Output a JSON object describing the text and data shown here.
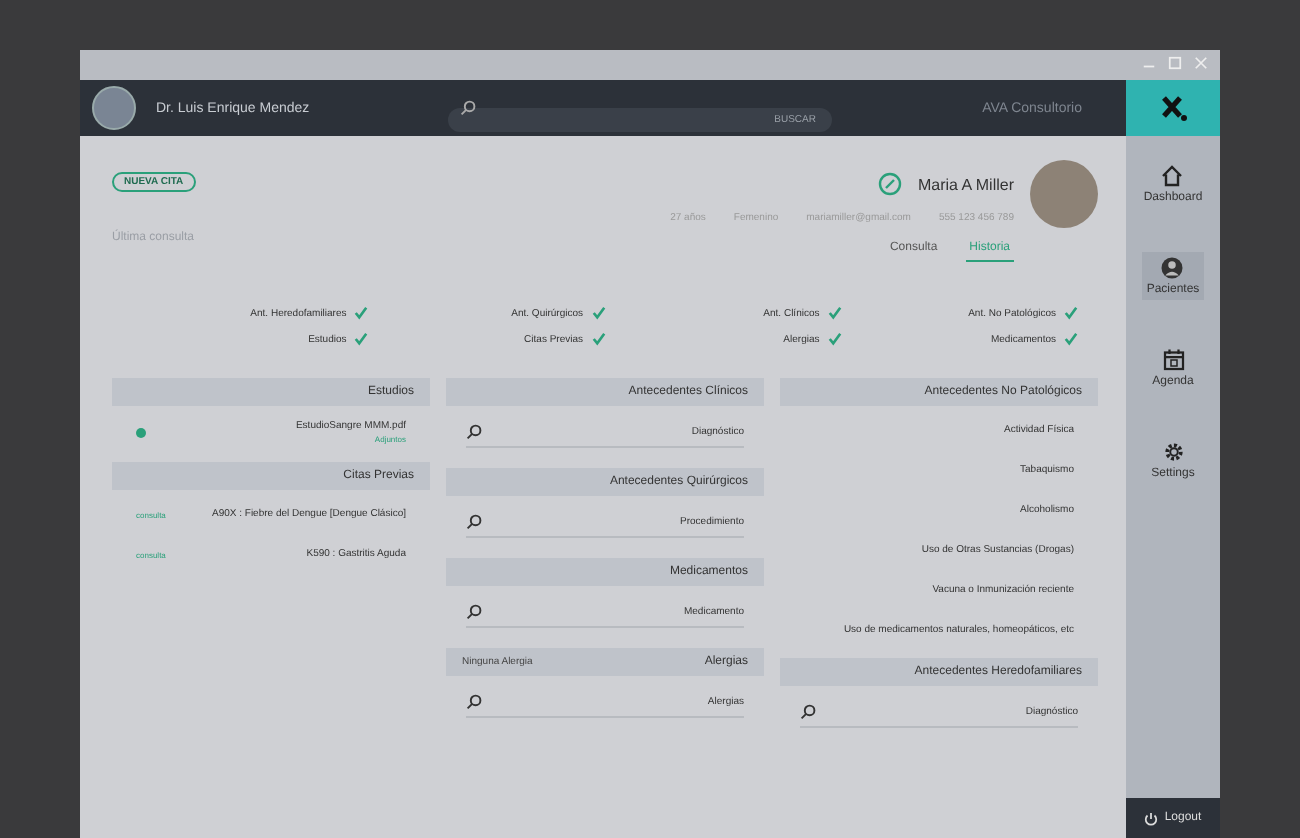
{
  "header": {
    "doctor": "Dr. Luis Enrique Mendez",
    "search": {
      "placeholder": "BUSCAR"
    },
    "app_title": "AVA Consultorio"
  },
  "sidebar": {
    "items": [
      {
        "label": "Dashboard",
        "selected": false
      },
      {
        "label": "Pacientes",
        "selected": true
      },
      {
        "label": "Agenda",
        "selected": false
      },
      {
        "label": "Settings",
        "selected": false
      }
    ],
    "logout": "Logout"
  },
  "patient": {
    "name": "Maria A Miller",
    "info": [
      "27 años",
      "Femenino",
      "mariamiller@gmail.com",
      "555 123 456 789"
    ],
    "new_appointment": "NUEVA CITA",
    "last_visit": "Última consulta"
  },
  "tabs": [
    {
      "label": "Consulta",
      "selected": false
    },
    {
      "label": "Historia",
      "selected": true
    }
  ],
  "filters": [
    {
      "label": "Ant. Heredofamiliares",
      "checked": true
    },
    {
      "label": "Ant. Quirúrgicos",
      "checked": true
    },
    {
      "label": "Ant. Clínicos",
      "checked": true
    },
    {
      "label": "Ant. No Patológicos",
      "checked": true
    },
    {
      "label": "Estudios",
      "checked": true
    },
    {
      "label": "Citas Previas",
      "checked": true
    },
    {
      "label": "Alergias",
      "checked": true
    },
    {
      "label": "Medicamentos",
      "checked": true
    }
  ],
  "columns": [
    [
      {
        "title": "Estudios",
        "items": [
          {
            "kind": "file",
            "label": "EstudioSangre MMM.pdf",
            "link": "Adjuntos"
          }
        ]
      },
      {
        "title": "Citas Previas",
        "items": [
          {
            "kind": "visit",
            "label": "A90X : Fiebre del Dengue [Dengue Clásico]",
            "link": "consulta"
          },
          {
            "kind": "visit",
            "label": "K590 : Gastritis Aguda",
            "link": "consulta"
          }
        ]
      }
    ],
    [
      {
        "title": "Antecedentes Clínicos",
        "items": [
          {
            "kind": "search",
            "placeholder": "Diagnóstico"
          }
        ]
      },
      {
        "title": "Antecedentes Quirúrgicos",
        "items": [
          {
            "kind": "search",
            "placeholder": "Procedimiento"
          }
        ]
      },
      {
        "title": "Medicamentos",
        "items": [
          {
            "kind": "search",
            "placeholder": "Medicamento"
          }
        ]
      },
      {
        "note": "Ninguna Alergia",
        "title": "Alergias",
        "items": [
          {
            "kind": "search",
            "placeholder": "Alergias"
          }
        ]
      }
    ],
    [
      {
        "title": "Antecedentes No Patológicos",
        "items": [
          {
            "kind": "text",
            "label": "Actividad Física"
          },
          {
            "kind": "text",
            "label": "Tabaquismo"
          },
          {
            "kind": "text",
            "label": "Alcoholismo"
          },
          {
            "kind": "text",
            "label": "Uso de Otras Sustancias (Drogas)"
          },
          {
            "kind": "text",
            "label": "Vacuna o Inmunización reciente"
          },
          {
            "kind": "text",
            "label": "Uso de medicamentos naturales, homeopáticos, etc"
          }
        ]
      },
      {
        "title": "Antecedentes Heredofamiliares",
        "items": [
          {
            "kind": "search",
            "placeholder": "Diagnóstico"
          }
        ]
      }
    ]
  ]
}
